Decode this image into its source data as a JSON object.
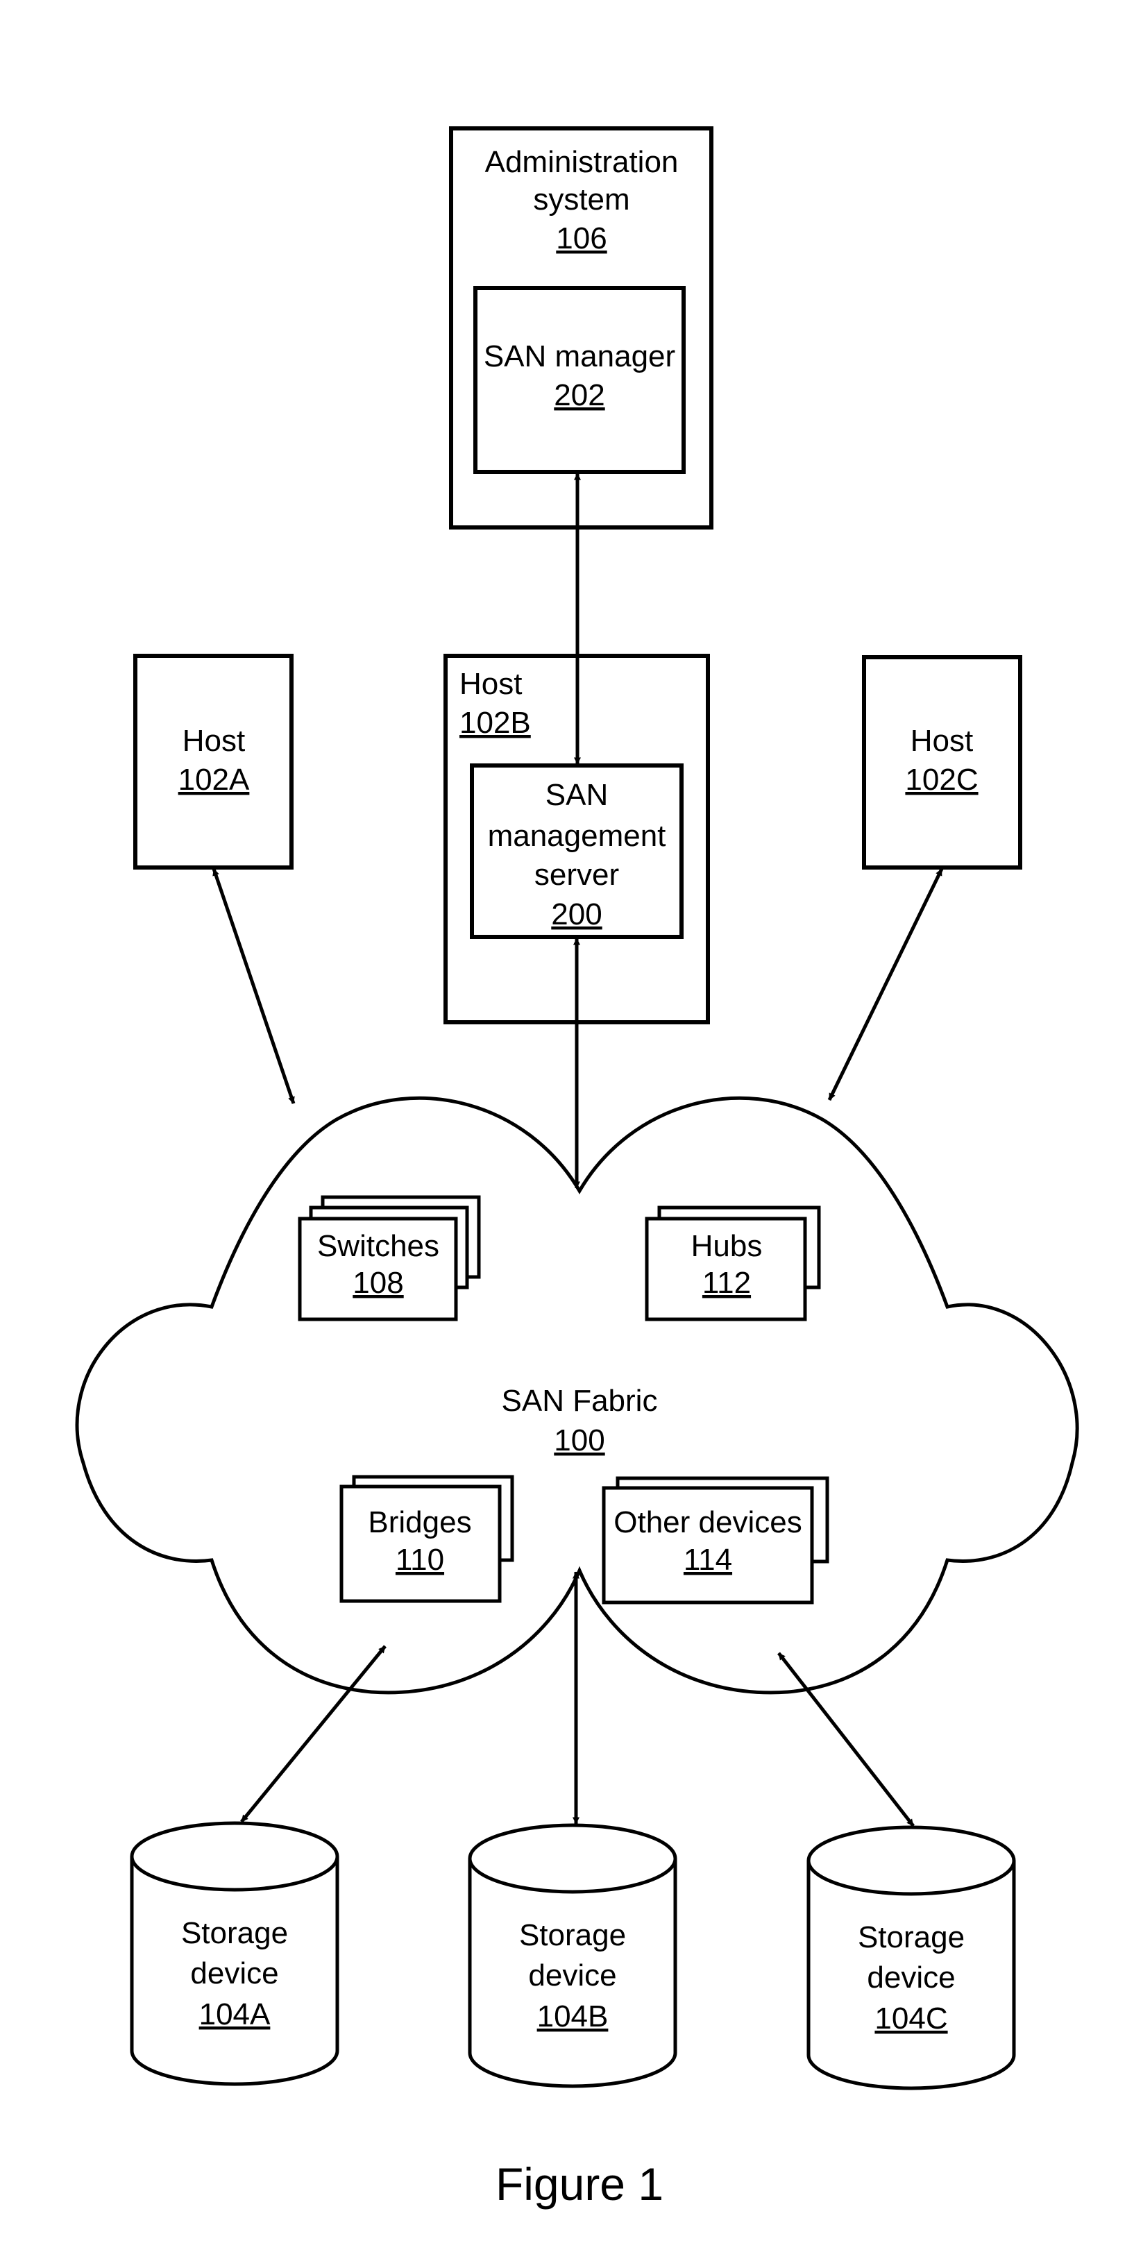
{
  "figure": {
    "caption": "Figure 1"
  },
  "admin_system": {
    "label_line1": "Administration",
    "label_line2": "system",
    "ref": "106",
    "san_manager": {
      "label": "SAN manager",
      "ref": "202"
    }
  },
  "hosts": [
    {
      "label": "Host",
      "ref": "102A"
    },
    {
      "label": "Host",
      "ref": "102B",
      "san_management_server": {
        "label_line1": "SAN",
        "label_line2": "management",
        "label_line3": "server",
        "ref": "200"
      }
    },
    {
      "label": "Host",
      "ref": "102C"
    }
  ],
  "san_fabric": {
    "label": "SAN Fabric",
    "ref": "100",
    "components": [
      {
        "label": "Switches",
        "ref": "108"
      },
      {
        "label": "Hubs",
        "ref": "112"
      },
      {
        "label": "Bridges",
        "ref": "110"
      },
      {
        "label": "Other devices",
        "ref": "114"
      }
    ]
  },
  "storage_devices": [
    {
      "label_line1": "Storage",
      "label_line2": "device",
      "ref": "104A"
    },
    {
      "label_line1": "Storage",
      "label_line2": "device",
      "ref": "104B"
    },
    {
      "label_line1": "Storage",
      "label_line2": "device",
      "ref": "104C"
    }
  ],
  "connections": [
    {
      "from": "SAN manager 202",
      "to": "SAN management server 200",
      "direction": "bidirectional"
    },
    {
      "from": "Host 102A",
      "to": "SAN Fabric 100",
      "direction": "bidirectional"
    },
    {
      "from": "SAN management server 200",
      "to": "SAN Fabric 100",
      "direction": "bidirectional"
    },
    {
      "from": "Host 102C",
      "to": "SAN Fabric 100",
      "direction": "bidirectional"
    },
    {
      "from": "SAN Fabric 100",
      "to": "Storage device 104A",
      "direction": "bidirectional"
    },
    {
      "from": "SAN Fabric 100",
      "to": "Storage device 104B",
      "direction": "bidirectional"
    },
    {
      "from": "SAN Fabric 100",
      "to": "Storage device 104C",
      "direction": "bidirectional"
    }
  ]
}
